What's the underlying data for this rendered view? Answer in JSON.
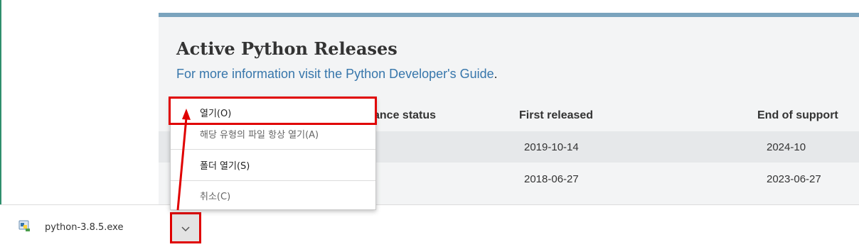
{
  "page": {
    "title": "Active Python Releases",
    "info_text": "For more information visit the Python Developer's Guide",
    "info_period": "."
  },
  "table": {
    "headers": [
      "ance status",
      "First released",
      "End of support"
    ],
    "rows": [
      {
        "first_released": "2019-10-14",
        "end_of_support": "2024-10"
      },
      {
        "first_released": "2018-06-27",
        "end_of_support": "2023-06-27"
      }
    ]
  },
  "context_menu": {
    "items": [
      "열기(O)",
      "해당 유형의 파일 항상 열기(A)",
      "폴더 열기(S)",
      "취소(C)"
    ]
  },
  "download_bar": {
    "file_name": "python-3.8.5.exe",
    "file_icon": "installer-icon",
    "menu_icon": "chevron-down-icon"
  },
  "colors": {
    "link": "#3776ab",
    "annotation": "#e00000",
    "panel_bg": "#f3f4f5",
    "accent_bar": "#7aa3bd"
  }
}
